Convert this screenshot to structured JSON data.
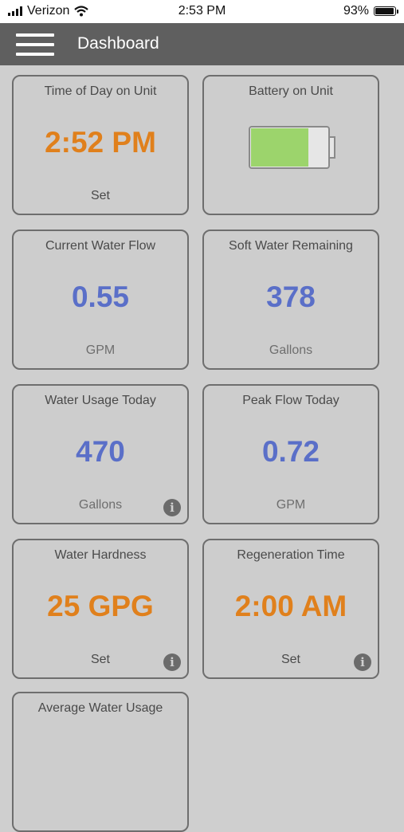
{
  "status_bar": {
    "carrier": "Verizon",
    "time": "2:53 PM",
    "battery_percent": "93%"
  },
  "header": {
    "title": "Dashboard"
  },
  "cards": {
    "time_of_day": {
      "title": "Time of Day on Unit",
      "value": "2:52 PM",
      "sub": "Set"
    },
    "battery": {
      "title": "Battery on Unit",
      "level": 0.75
    },
    "current_flow": {
      "title": "Current Water Flow",
      "value": "0.55",
      "sub": "GPM"
    },
    "soft_water": {
      "title": "Soft Water Remaining",
      "value": "378",
      "sub": "Gallons"
    },
    "usage_today": {
      "title": "Water Usage Today",
      "value": "470",
      "sub": "Gallons"
    },
    "peak_flow": {
      "title": "Peak Flow Today",
      "value": "0.72",
      "sub": "GPM"
    },
    "hardness": {
      "title": "Water Hardness",
      "value": "25 GPG",
      "sub": "Set"
    },
    "regeneration": {
      "title": "Regeneration Time",
      "value": "2:00 AM",
      "sub": "Set"
    },
    "average_usage": {
      "title": "Average Water Usage"
    }
  },
  "icons": {
    "info": "i"
  },
  "colors": {
    "orange": "#e0801c",
    "blue": "#5a6fc8",
    "battery_green": "#9cd46c"
  }
}
